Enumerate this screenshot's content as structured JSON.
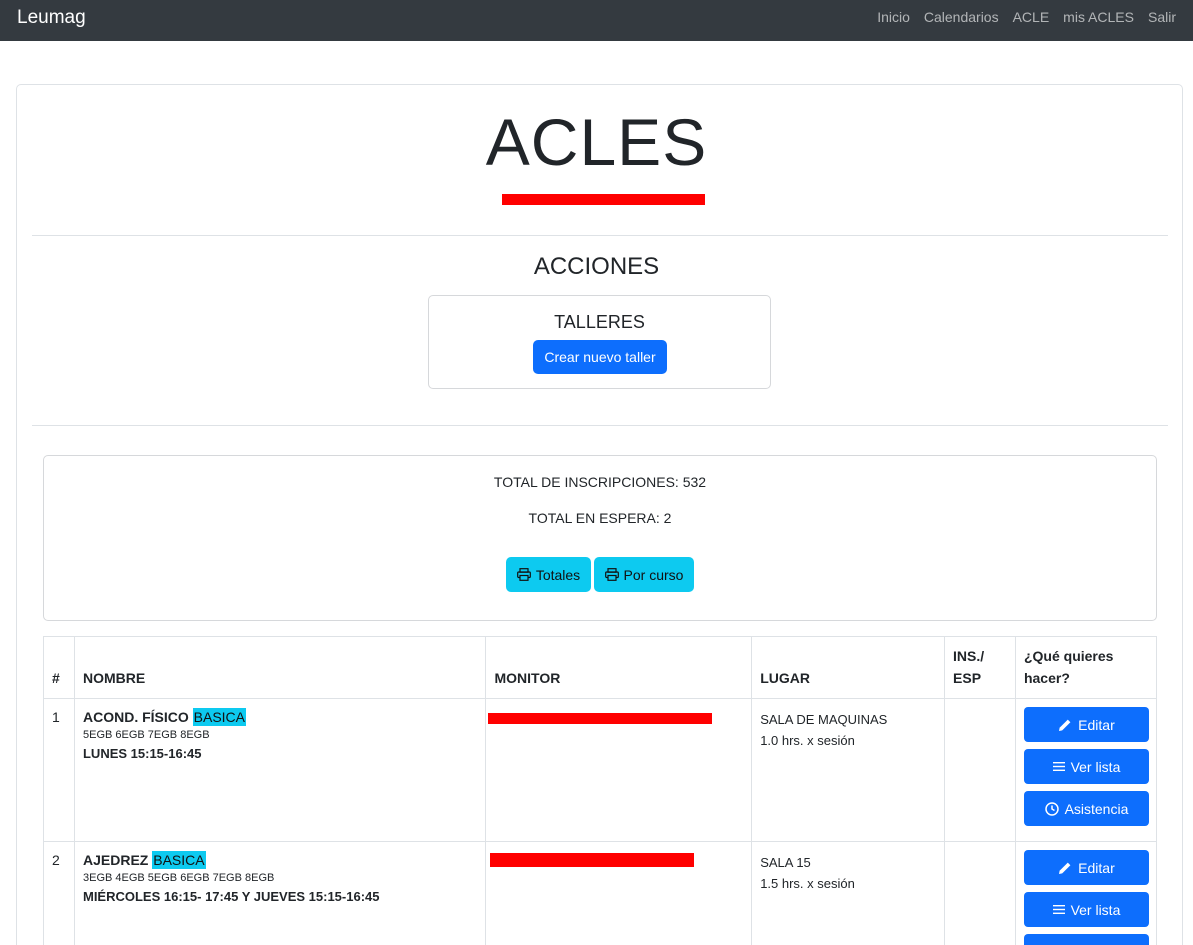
{
  "navbar": {
    "brand": "Leumag",
    "links": [
      "Inicio",
      "Calendarios",
      "ACLE",
      "mis ACLES",
      "Salir"
    ]
  },
  "header": {
    "title": "ACLES",
    "subtitle": "[redacted email]"
  },
  "acciones": {
    "title": "ACCIONES",
    "talleres_title": "TALLERES",
    "create_button": "Crear nuevo taller"
  },
  "stats": {
    "total_inscripciones": "TOTAL DE INSCRIPCIONES: 532",
    "total_espera": "TOTAL EN ESPERA: 2",
    "btn_totales": "Totales",
    "btn_por_curso": "Por curso"
  },
  "table": {
    "headers": [
      "#",
      "NOMBRE",
      "MONITOR",
      "LUGAR",
      "INS./ ESP",
      "¿Qué quieres hacer?"
    ],
    "rows": [
      {
        "num": "1",
        "name": "ACOND. FÍSICO",
        "level": "BASICA",
        "grades": "5EGB 6EGB 7EGB 8EGB",
        "schedule": "LUNES 15:15-16:45",
        "monitor": "[redacted]",
        "lugar": "SALA DE MAQUINAS",
        "horas": "1.0 hrs. x sesión",
        "ins_esp": ""
      },
      {
        "num": "2",
        "name": "AJEDREZ",
        "level": "BASICA",
        "grades": "3EGB 4EGB 5EGB 6EGB 7EGB 8EGB",
        "schedule": "MIÉRCOLES 16:15- 17:45 Y JUEVES 15:15-16:45",
        "monitor": "[redacted]",
        "lugar": "SALA 15",
        "horas": "1.5 hrs. x sesión",
        "ins_esp": ""
      }
    ],
    "actions": {
      "edit": "Editar",
      "list": "Ver lista",
      "attendance": "Asistencia"
    }
  },
  "colors": {
    "navbar": "#343a40",
    "primary": "#0d6efd",
    "info": "#0dcaf0",
    "redaction": "#ff0000"
  }
}
